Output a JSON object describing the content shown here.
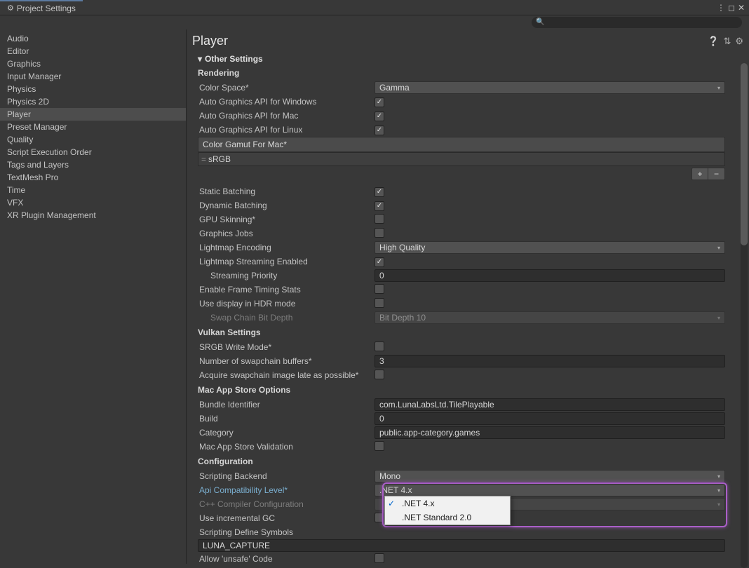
{
  "window": {
    "title": "Project Settings"
  },
  "sidebar": {
    "items": [
      "Audio",
      "Editor",
      "Graphics",
      "Input Manager",
      "Physics",
      "Physics 2D",
      "Player",
      "Preset Manager",
      "Quality",
      "Script Execution Order",
      "Tags and Layers",
      "TextMesh Pro",
      "Time",
      "VFX",
      "XR Plugin Management"
    ],
    "selected": "Player"
  },
  "header": {
    "title": "Player"
  },
  "foldout": "Other Settings",
  "sections": {
    "rendering": {
      "title": "Rendering",
      "color_space_label": "Color Space*",
      "color_space_value": "Gamma",
      "auto_win": "Auto Graphics API  for Windows",
      "auto_mac": "Auto Graphics API  for Mac",
      "auto_linux": "Auto Graphics API  for Linux",
      "gamut_label": "Color Gamut For Mac*",
      "gamut_value": "sRGB",
      "static_batch": "Static Batching",
      "dyn_batch": "Dynamic Batching",
      "gpu_skin": "GPU Skinning*",
      "gfx_jobs": "Graphics Jobs",
      "lm_encoding_label": "Lightmap Encoding",
      "lm_encoding_value": "High Quality",
      "lm_stream": "Lightmap Streaming Enabled",
      "stream_prio_label": "Streaming Priority",
      "stream_prio_value": "0",
      "frame_timing": "Enable Frame Timing Stats",
      "hdr_display": "Use display in HDR mode",
      "swap_bitdepth_label": "Swap Chain Bit Depth",
      "swap_bitdepth_value": "Bit Depth 10"
    },
    "vulkan": {
      "title": "Vulkan Settings",
      "srgb_write": "SRGB Write Mode*",
      "num_swap_label": "Number of swapchain buffers*",
      "num_swap_value": "3",
      "acquire_late": "Acquire swapchain image late as possible*"
    },
    "mac": {
      "title": "Mac App Store Options",
      "bundle_label": "Bundle Identifier",
      "bundle_value": "com.LunaLabsLtd.TilePlayable",
      "build_label": "Build",
      "build_value": "0",
      "category_label": "Category",
      "category_value": "public.app-category.games",
      "validation": "Mac App Store Validation"
    },
    "config": {
      "title": "Configuration",
      "backend_label": "Scripting Backend",
      "backend_value": "Mono",
      "api_label": "Api Compatibility Level*",
      "api_value": ".NET 4.x",
      "cpp_label": "C++ Compiler Configuration",
      "inc_gc": "Use incremental GC",
      "define_label": "Scripting Define Symbols",
      "define_value": "LUNA_CAPTURE",
      "unsafe": "Allow 'unsafe' Code"
    }
  },
  "popup": {
    "items": [
      {
        "label": ".NET 4.x",
        "checked": true
      },
      {
        "label": ".NET Standard 2.0",
        "checked": false
      }
    ]
  }
}
